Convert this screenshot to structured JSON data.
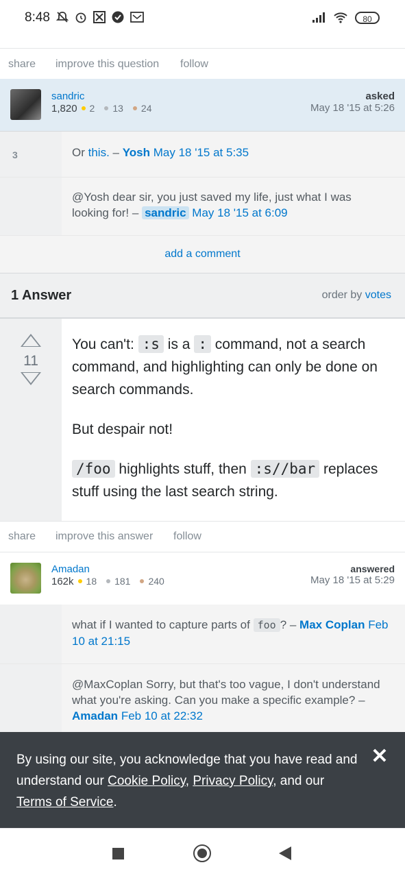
{
  "status_bar": {
    "time": "8:48",
    "battery": "80",
    "icons": [
      "mute-icon",
      "alarm-icon",
      "app-icon",
      "check-icon",
      "mail-icon",
      "signal-icon",
      "wifi-icon",
      "battery-icon"
    ]
  },
  "question_links": {
    "share": "share",
    "improve": "improve this question",
    "follow": "follow"
  },
  "question_user": {
    "name": "sandric",
    "rep": "1,820",
    "gold": "2",
    "silver": "13",
    "bronze": "24",
    "action": "asked",
    "date": "May 18 '15 at 5:26"
  },
  "question_comments": [
    {
      "score": "3",
      "pre": "Or ",
      "link": "this.",
      "dash": " – ",
      "author": "Yosh",
      "date": "May 18 '15 at 5:35"
    },
    {
      "text": "@Yosh dear sir, you just saved my life, just what I was looking for! – ",
      "author": "sandric",
      "date": "May 18 '15 at 6:09"
    }
  ],
  "add_comment": "add a comment",
  "answers_header": {
    "title": "1 Answer",
    "order_prefix": "order by ",
    "order_link": "votes"
  },
  "answer": {
    "votes": "11",
    "p1_a": "You can't: ",
    "p1_code1": ":s",
    "p1_b": " is a ",
    "p1_code2": ":",
    "p1_c": " command, not a search command, and highlighting can only be done on search commands.",
    "p2": "But despair not!",
    "p3_code1": "/foo",
    "p3_a": " highlights stuff, then ",
    "p3_code2": ":s//bar",
    "p3_b": " replaces stuff using the last search string."
  },
  "answer_links": {
    "share": "share",
    "improve": "improve this answer",
    "follow": "follow"
  },
  "answer_user": {
    "name": "Amadan",
    "rep": "162k",
    "gold": "18",
    "silver": "181",
    "bronze": "240",
    "action": "answered",
    "date": "May 18 '15 at 5:29"
  },
  "answer_comments": [
    {
      "pre": "what if I wanted to capture parts of ",
      "code": "foo",
      "post": "? – ",
      "author": "Max Coplan",
      "date": "Feb 10 at 21:15"
    },
    {
      "text": "@MaxCoplan Sorry, but that's too vague, I don't understand what you're asking. Can you make a specific example? – ",
      "author": "Amadan",
      "date": "Feb 10 at 22:32"
    }
  ],
  "cookie_banner": {
    "pre": "By using our site, you acknowledge that you have read and understand our ",
    "cookie": "Cookie Policy",
    "comma": ", ",
    "privacy": "Privacy Policy",
    "mid": ", and our ",
    "terms": "Terms of Service",
    "end": ".",
    "close": "✕"
  },
  "colors": {
    "link": "#0077cc",
    "badge_gold": "#ffcc01",
    "badge_silver": "#b4b8bc",
    "badge_bronze": "#d1a684",
    "user_card_bg": "#e1ecf4",
    "banner_bg": "#3b4045"
  }
}
